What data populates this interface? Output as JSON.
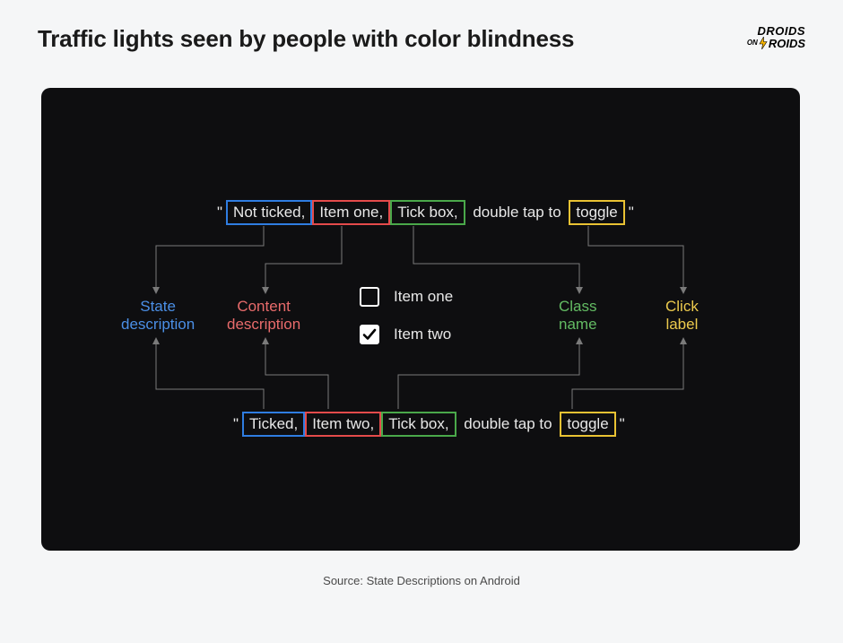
{
  "title": "Traffic lights seen by people with color blindness",
  "source": "Source: State Descriptions on Android",
  "logo": {
    "line1": "DROIDS",
    "on": "ON",
    "line2": "ROIDS"
  },
  "top_strip": {
    "prefix": "\"",
    "state": "Not ticked,",
    "content": "Item one,",
    "class": "Tick box,",
    "middle": " double tap to ",
    "click": "toggle",
    "suffix": "\""
  },
  "bottom_strip": {
    "prefix": "\"",
    "state": "Ticked,",
    "content": "Item two,",
    "class": "Tick box,",
    "middle": " double tap to ",
    "click": "toggle",
    "suffix": "\""
  },
  "labels": {
    "state": "State\ndescription",
    "content": "Content\ndescription",
    "class": "Class\nname",
    "click": "Click\nlabel"
  },
  "items": {
    "one": "Item one",
    "two": "Item two"
  }
}
